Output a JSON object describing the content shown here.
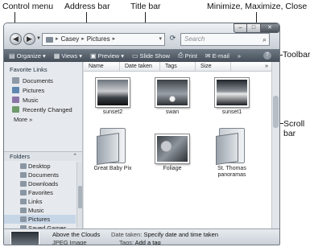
{
  "callouts": {
    "control_menu": "Control menu",
    "address_bar": "Address bar",
    "title_bar": "Title bar",
    "window_controls": "Minimize, Maximize, Close",
    "toolbar": "Toolbar",
    "scroll_bar_1": "Scroll",
    "scroll_bar_2": "bar"
  },
  "titlebar": {
    "back_icon": "back-arrow-icon",
    "forward_icon": "forward-arrow-icon",
    "address": [
      "Casey",
      "Pictures"
    ],
    "search_placeholder": "Search"
  },
  "window_controls": {
    "minimize": "–",
    "maximize": "□",
    "close": "✕"
  },
  "toolbar": {
    "items": [
      "Organize",
      "Views",
      "Preview",
      "Slide Show",
      "Print",
      "E-mail",
      "»"
    ],
    "help": "?"
  },
  "sidebar": {
    "favorites_title": "Favorite Links",
    "favorites": [
      {
        "label": "Documents",
        "color": "#8e98a6"
      },
      {
        "label": "Pictures",
        "color": "#5f87b0"
      },
      {
        "label": "Music",
        "color": "#8b74a8"
      },
      {
        "label": "Recently Changed",
        "color": "#6f9a6a"
      }
    ],
    "more": "More  »",
    "folders_title": "Folders",
    "folders": [
      "Desktop",
      "Documents",
      "Downloads",
      "Favorites",
      "Links",
      "Music",
      "Pictures",
      "Saved Games"
    ],
    "selected_folder": "Pictures"
  },
  "columns": [
    "Name",
    "Date taken",
    "Tags",
    "Size",
    "»"
  ],
  "items": [
    "sunset2",
    "swan",
    "sunset1",
    "Great Baby Pix",
    "Foliage",
    "St. Thomas panoramas"
  ],
  "details": {
    "name": "Above the Clouds",
    "type": "JPEG Image",
    "date_label": "Date taken:",
    "date_value": "Specify date and time taken",
    "tags_label": "Tags:",
    "tags_value": "Add a tag"
  }
}
